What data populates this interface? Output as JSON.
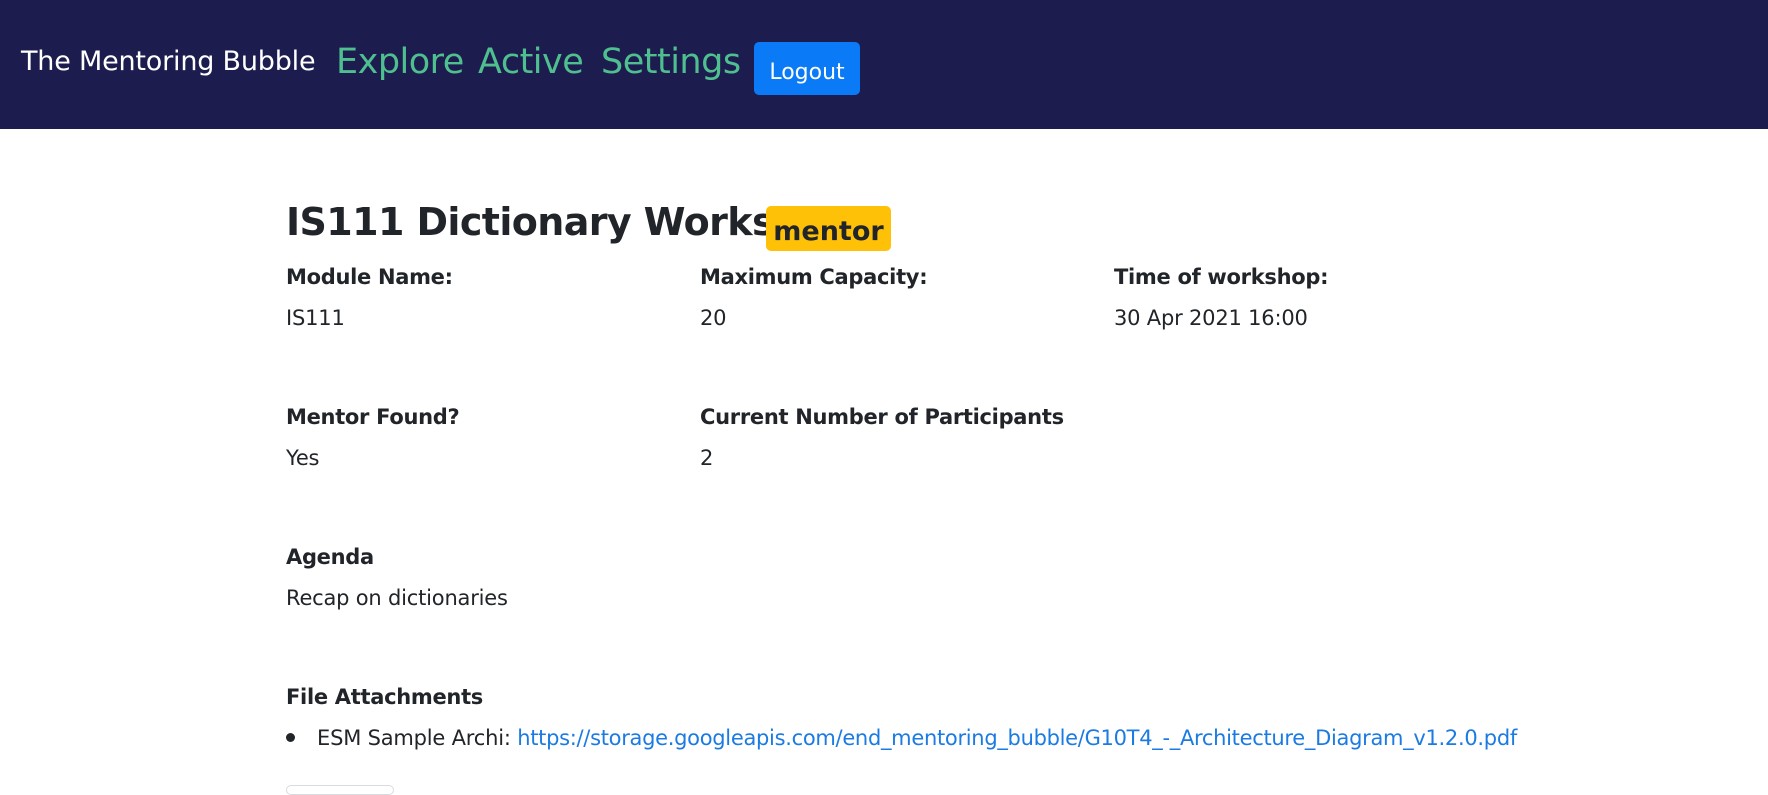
{
  "navbar": {
    "brand": "The Mentoring Bubble",
    "links": [
      {
        "label": "Explore"
      },
      {
        "label": "Active"
      },
      {
        "label": "Settings"
      }
    ],
    "logout_label": "Logout",
    "colors": {
      "background": "#1c1c4f",
      "link": "#4fbf8f",
      "logout_button": "#0b7af7"
    }
  },
  "workshop": {
    "title": "IS111 Dictionary Workshop",
    "role_badge": "mentor",
    "badge_color": "#ffc107",
    "fields": {
      "module_name": {
        "label": "Module Name:",
        "value": "IS111"
      },
      "max_capacity": {
        "label": "Maximum Capacity:",
        "value": "20"
      },
      "time": {
        "label": "Time of workshop:",
        "value": "30 Apr 2021 16:00"
      },
      "mentor_found": {
        "label": "Mentor Found?",
        "value": "Yes"
      },
      "participants": {
        "label": "Current Number of Participants",
        "value": "2"
      },
      "agenda": {
        "label": "Agenda",
        "value": "Recap on dictionaries"
      }
    },
    "attachments": {
      "label": "File Attachments",
      "items": [
        {
          "name": "ESM Sample Archi:",
          "link": "https://storage.googleapis.com/end_mentoring_bubble/G10T4_-_Architecture_Diagram_v1.2.0.pdf"
        }
      ]
    }
  }
}
